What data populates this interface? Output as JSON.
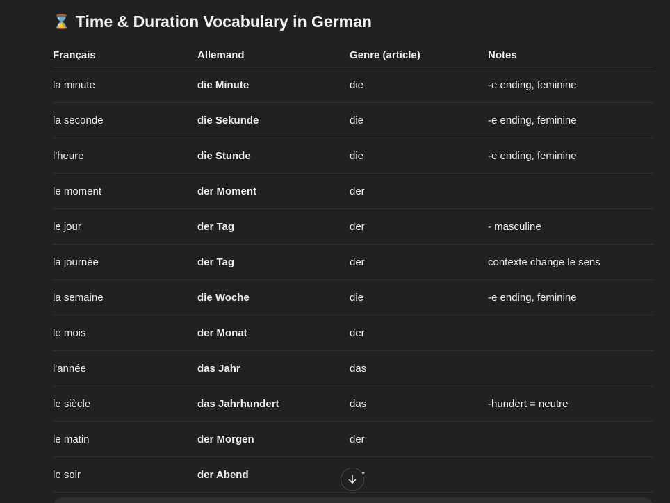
{
  "heading": {
    "emoji": "⌛",
    "title": "Time & Duration Vocabulary in German"
  },
  "table": {
    "headers": [
      "Français",
      "Allemand",
      "Genre (article)",
      "Notes"
    ],
    "rows": [
      {
        "fr": "la minute",
        "de": "die Minute",
        "genre": "die",
        "notes": "-e ending, feminine"
      },
      {
        "fr": "la seconde",
        "de": "die Sekunde",
        "genre": "die",
        "notes": "-e ending, feminine"
      },
      {
        "fr": "l'heure",
        "de": "die Stunde",
        "genre": "die",
        "notes": "-e ending, feminine"
      },
      {
        "fr": "le moment",
        "de": "der Moment",
        "genre": "der",
        "notes": ""
      },
      {
        "fr": "le jour",
        "de": "der Tag",
        "genre": "der",
        "notes": "- masculine"
      },
      {
        "fr": "la journée",
        "de": "der Tag",
        "genre": "der",
        "notes": "contexte change le sens"
      },
      {
        "fr": "la semaine",
        "de": "die Woche",
        "genre": "die",
        "notes": "-e ending, feminine"
      },
      {
        "fr": "le mois",
        "de": "der Monat",
        "genre": "der",
        "notes": ""
      },
      {
        "fr": "l'année",
        "de": "das Jahr",
        "genre": "das",
        "notes": ""
      },
      {
        "fr": "le siècle",
        "de": "das Jahrhundert",
        "genre": "das",
        "notes": "-hundert = neutre"
      },
      {
        "fr": "le matin",
        "de": "der Morgen",
        "genre": "der",
        "notes": ""
      },
      {
        "fr": "le soir",
        "de": "der Abend",
        "genre": "der",
        "notes": ""
      }
    ]
  },
  "scroll_button": {
    "icon": "arrow-down-icon"
  }
}
